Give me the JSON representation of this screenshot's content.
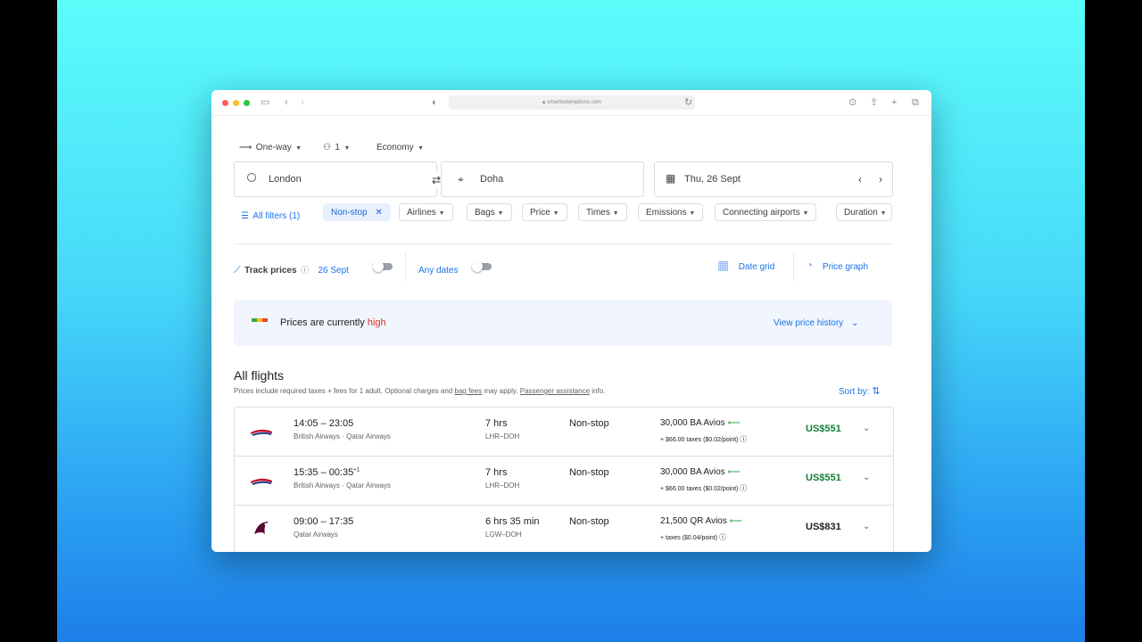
{
  "browser": {
    "url": "smartredemptions.com"
  },
  "search": {
    "trip_type": "One-way",
    "passengers": "1",
    "cabin": "Economy",
    "origin": "London",
    "destination": "Doha",
    "date": "Thu, 26 Sept"
  },
  "filters": {
    "all_filters": "All filters (1)",
    "active_chip": "Non-stop",
    "chips": [
      "Airlines",
      "Bags",
      "Price",
      "Times",
      "Emissions",
      "Connecting airports",
      "Duration"
    ]
  },
  "tracking": {
    "track_prices": "Track prices",
    "date_label": "26 Sept",
    "any_dates": "Any dates",
    "date_grid": "Date grid",
    "price_graph": "Price graph"
  },
  "price_banner": {
    "text": "Prices are currently",
    "level": "high",
    "history_link": "View price history"
  },
  "results": {
    "title": "All flights",
    "note_prefix": "Prices include required taxes + fees for 1 adult. Optional charges and",
    "note_link1": "bag fees",
    "note_mid": "may apply.",
    "note_link2": "Passenger assistance",
    "note_suffix": "info.",
    "sort_label": "Sort by:",
    "flights": [
      {
        "times": "14:05 – 23:05",
        "plus_day": "",
        "airline": "British Airways · Qatar Airways",
        "duration": "7 hrs",
        "route": "LHR–DOH",
        "stops": "Non-stop",
        "avios": "30,000 BA Avios",
        "taxes": "+ $66.00 taxes ($0.02/point)",
        "price": "US$551"
      },
      {
        "times": "15:35 – 00:35",
        "plus_day": "+1",
        "airline": "British Airways · Qatar Airways",
        "duration": "7 hrs",
        "route": "LHR–DOH",
        "stops": "Non-stop",
        "avios": "30,000 BA Avios",
        "taxes": "+ $66.00 taxes ($0.02/point)",
        "price": "US$551"
      },
      {
        "times": "09:00 – 17:35",
        "plus_day": "",
        "airline": "Qatar Airways",
        "duration": "6 hrs 35 min",
        "route": "LGW–DOH",
        "stops": "Non-stop",
        "avios": "21,500 QR Avios",
        "taxes": "+ taxes ($0.04/point)",
        "price": "US$831"
      }
    ]
  },
  "colors": {
    "price_high": "#d93025",
    "price_green": "#188038",
    "link_blue": "#1a73e8",
    "arrow_green": "#34a853"
  }
}
